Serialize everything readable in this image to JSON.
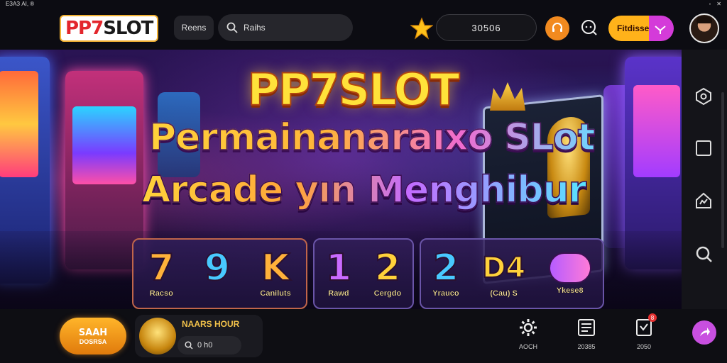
{
  "status_bar": {
    "left": "ЕЗАЗ АІ, ®",
    "right_icon_1": "signal-icon",
    "right_icon_2": "close-icon"
  },
  "header": {
    "logo_pp": "PP7",
    "logo_slot": "SLOT",
    "nav_chip": "Reens",
    "search_placeholder": "Raihs",
    "star_icon": "star-icon",
    "balance": "30506",
    "support_icon": "headset-icon",
    "chat_icon": "chat-icon",
    "promo_label": "Fitdisse",
    "promo_icon": "gift-icon",
    "avatar_icon": "avatar"
  },
  "banner": {
    "title_1": "PP7SLOT",
    "title_2": "Permainanaraıxo SLot",
    "title_3": "Arcade yın Menghibur",
    "tiles": [
      {
        "items": [
          {
            "glyph": "7",
            "color": "orange",
            "label": "Racso"
          },
          {
            "glyph": "9",
            "color": "cyan",
            "label": ""
          },
          {
            "glyph": "K",
            "color": "orange",
            "label": "Caniluts"
          }
        ]
      },
      {
        "items": [
          {
            "glyph": "1",
            "color": "purple",
            "label": "Rawd"
          },
          {
            "glyph": "2",
            "color": "gold",
            "label": "Cergdo"
          }
        ]
      },
      {
        "items": [
          {
            "glyph": "2",
            "color": "cyan",
            "label": "Yrauco"
          },
          {
            "glyph": "D4",
            "color": "gold",
            "label": "(Cau) S"
          },
          {
            "glyph": "",
            "color": "pink",
            "label": "Ykese8"
          }
        ]
      }
    ]
  },
  "rail": {
    "items": [
      "refresh-icon",
      "square-icon",
      "home-icon",
      "search-icon"
    ]
  },
  "bottom_bar": {
    "spin_label": "SAAH",
    "spin_sub": "DOSRSA",
    "game_title": "NAARS HOUR",
    "game_sub": "0 h0",
    "tabs": [
      {
        "icon": "settings-icon",
        "label": "AOCH"
      },
      {
        "icon": "news-icon",
        "label": "20385"
      },
      {
        "icon": "document-icon",
        "label": "2050",
        "badge": "8"
      }
    ],
    "share_icon": "share-icon"
  },
  "colors": {
    "accent": "#f28a1f",
    "promo_pink": "#d43bd9",
    "bg": "#0c0c12"
  }
}
